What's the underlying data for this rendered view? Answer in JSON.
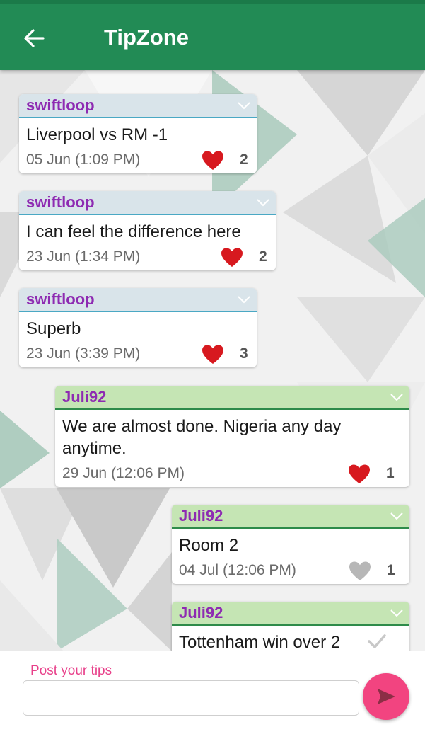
{
  "app": {
    "title": "TipZone"
  },
  "colors": {
    "appbar": "#228b55",
    "sender": "#8e2bb2",
    "heart_active": "#d7191f",
    "heart_inactive": "#b7b7b7",
    "send_button": "#f24480",
    "composer_label": "#e8408a"
  },
  "icons": {
    "back": "arrow-left-icon",
    "menu": "chevron-down-icon",
    "like": "heart-icon",
    "sent": "check-icon",
    "send": "send-icon"
  },
  "messages": [
    {
      "sender": "swiftloop",
      "text": "Liverpool vs RM  -1",
      "date": "05 Jun",
      "time": "(1:09 PM)",
      "likes": "2",
      "liked": true,
      "direction": "incoming"
    },
    {
      "sender": "swiftloop",
      "text": "I can feel the difference here",
      "date": "23 Jun",
      "time": "(1:34 PM)",
      "likes": "2",
      "liked": true,
      "direction": "incoming"
    },
    {
      "sender": "swiftloop",
      "text": "Superb",
      "date": "23 Jun",
      "time": "(3:39 PM)",
      "likes": "3",
      "liked": true,
      "direction": "incoming"
    },
    {
      "sender": "Juli92",
      "text": "We are almost done. Nigeria any day anytime.",
      "date": "29 Jun",
      "time": "(12:06 PM)",
      "likes": "1",
      "liked": true,
      "direction": "outgoing"
    },
    {
      "sender": "Juli92",
      "text": "Room 2",
      "date": "04 Jul",
      "time": "(12:06 PM)",
      "likes": "1",
      "liked": false,
      "direction": "outgoing"
    },
    {
      "sender": "Juli92",
      "text": "Tottenham win over 2",
      "date": "",
      "time": "",
      "likes": "",
      "liked": false,
      "direction": "outgoing"
    }
  ],
  "composer": {
    "label": "Post your tips",
    "value": "",
    "placeholder": ""
  }
}
